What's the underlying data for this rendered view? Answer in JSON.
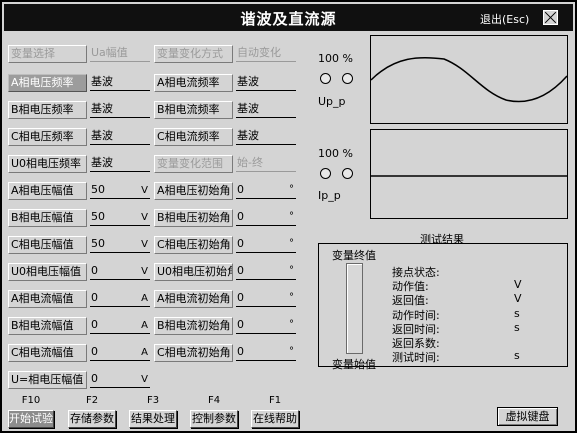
{
  "title": "谐波及直流源",
  "exit_label": "退出(Esc)",
  "header_row": {
    "col1_label": "变量选择",
    "col1_value": "Ua幅值",
    "col2_label": "变量变化方式",
    "col2_value": "自动变化"
  },
  "freq_rows": [
    {
      "label_a": "A相电压频率",
      "value_a": "基波",
      "label_b": "A相电流频率",
      "value_b": "基波"
    },
    {
      "label_a": "B相电压频率",
      "value_a": "基波",
      "label_b": "B相电流频率",
      "value_b": "基波"
    },
    {
      "label_a": "C相电压频率",
      "value_a": "基波",
      "label_b": "C相电流频率",
      "value_b": "基波"
    },
    {
      "label_a": "U0相电压频率",
      "value_a": "基波",
      "label_b": "变量变化范围",
      "value_b": "始-终"
    }
  ],
  "amp_rows": [
    {
      "label_a": "A相电压幅值",
      "value_a": "50",
      "unit_a": "V",
      "label_b": "A相电压初始角",
      "value_b": "0",
      "unit_b": "°"
    },
    {
      "label_a": "B相电压幅值",
      "value_a": "50",
      "unit_a": "V",
      "label_b": "B相电压初始角",
      "value_b": "0",
      "unit_b": "°"
    },
    {
      "label_a": "C相电压幅值",
      "value_a": "50",
      "unit_a": "V",
      "label_b": "C相电压初始角",
      "value_b": "0",
      "unit_b": "°"
    },
    {
      "label_a": "U0相电压幅值",
      "value_a": "0",
      "unit_a": "V",
      "label_b": "U0相电压初始角",
      "value_b": "0",
      "unit_b": "°"
    },
    {
      "label_a": "A相电流幅值",
      "value_a": "0",
      "unit_a": "A",
      "label_b": "A相电流初始角",
      "value_b": "0",
      "unit_b": "°"
    },
    {
      "label_a": "B相电流幅值",
      "value_a": "0",
      "unit_a": "A",
      "label_b": "B相电流初始角",
      "value_b": "0",
      "unit_b": "°"
    },
    {
      "label_a": "C相电流幅值",
      "value_a": "0",
      "unit_a": "A",
      "label_b": "C相电流初始角",
      "value_b": "0",
      "unit_b": "°"
    }
  ],
  "dc_row": {
    "label": "U=相电压幅值",
    "value": "0",
    "unit": "V"
  },
  "waveforms": {
    "voltage": {
      "scale": "100 %",
      "label": "Up_p"
    },
    "current": {
      "scale": "100 %",
      "label": "Ip_p"
    }
  },
  "results": {
    "title": "测试结果",
    "var_end": "变量终值",
    "var_start": "变量始值",
    "rows": [
      {
        "label": "接点状态:",
        "unit": ""
      },
      {
        "label": "动作值:",
        "unit": "V"
      },
      {
        "label": "返回值:",
        "unit": "V"
      },
      {
        "label": "动作时间:",
        "unit": "s"
      },
      {
        "label": "返回时间:",
        "unit": "s"
      },
      {
        "label": "返回系数:",
        "unit": ""
      },
      {
        "label": "测试时间:",
        "unit": "s"
      }
    ]
  },
  "function_keys": [
    {
      "key": "F10",
      "label": "开始试验"
    },
    {
      "key": "F2",
      "label": "存储参数"
    },
    {
      "key": "F3",
      "label": "结果处理"
    },
    {
      "key": "F4",
      "label": "控制参数"
    },
    {
      "key": "F1",
      "label": "在线帮助"
    }
  ],
  "virtual_keyboard": "虚拟键盘"
}
